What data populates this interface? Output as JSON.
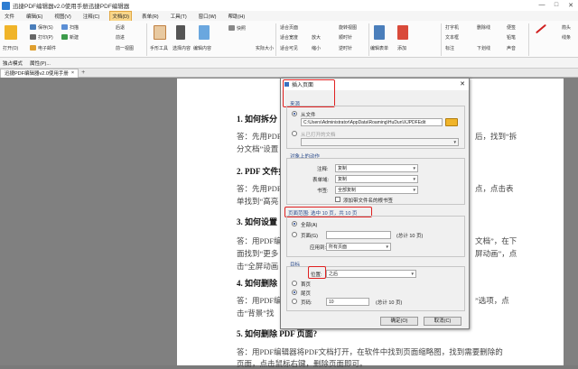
{
  "window": {
    "title": "迅捷PDF编辑器v2.0使用手册迅捷PDF编辑器"
  },
  "menu": [
    "文件",
    "编辑(E)",
    "视图(V)",
    "注释(C)",
    "文档(D)",
    "表单(R)",
    "工具(T)",
    "窗口(W)",
    "帮助(H)"
  ],
  "ribbon": {
    "open": "打开(O)",
    "save": "保存(S)",
    "print": "打印(P)",
    "email": "电子邮件",
    "scan": "扫描",
    "create": "新建",
    "back": "后退",
    "forward": "前进",
    "prev_view": "前一视图",
    "next_view": "后一视图",
    "hand_tool": "手形工具",
    "select_content": "选择内容",
    "edit_content": "编辑内容",
    "add_text": "添加文本",
    "snapshot": "快照",
    "actual_size": "实际大小",
    "fit_page": "适合页面",
    "fit_width": "适合宽度",
    "fit_visible": "适合可见",
    "find": "查找",
    "zoom_in": "放大",
    "zoom_out": "缩小",
    "zoom_pct": "100%",
    "rotate_view": "旋转视图",
    "rotate_cw": "顺时针",
    "rotate_ccw": "逆时针",
    "typewriter": "打字机",
    "textbox": "文本框",
    "callout": "标注",
    "strikeout": "删除线",
    "underline": "下划线",
    "sticky": "便签",
    "pencil": "铅笔",
    "sound": "声音",
    "arrow": "箭头",
    "line": "线条",
    "edit_form": "编辑表单",
    "insert_page": "插入页面",
    "add_item": "添加"
  },
  "modebar": [
    "独占模式",
    "属性(P)..."
  ],
  "tab": {
    "label": "迅捷PDF编辑器v2.0使用手册",
    "close": "×"
  },
  "document": {
    "h1": "1.  如何拆分",
    "p1a": "答：先用PDF",
    "p1a_r": "后，找到“拆",
    "p1b": "分文档”设置",
    "h2": "2.  PDF 文件如",
    "p2a": "答：先用PDF",
    "p2a_r": "点，点击表",
    "p2b": "单找到“高亮",
    "h3": "3.  如何设置",
    "p3a": "答：用PDF编",
    "p3a_r": "文档”，在下",
    "p3b": "面找到“更多",
    "p3b_r": "屏动画”，点",
    "p3c": "击“全屏动画",
    "h4": "4.  如何删除",
    "p4a": "答：用PDF编",
    "p4a_r": "”选项，点",
    "p4b": "击“背景”找",
    "h5": "5.  如何删除 PDF 页面?",
    "p5a": "答：用PDF编辑器将PDF文档打开，在软件中找到页面缩略图，找到需要删除的",
    "p5b": "页面，点击鼠标右键，删除页面即可。"
  },
  "dialog": {
    "title": "插入页面",
    "source_label": "来源",
    "from_file": "从文件",
    "file_path": "C:\\Users\\Administrator\\AppData\\Roaming\\HuDun\\XJPDFEdit",
    "from_open": "从已打开的文档",
    "actions_label": "对象上的动作",
    "comments_label": "注释:",
    "comments_value": "复制",
    "forms_label": "表单域:",
    "forms_value": "复制",
    "bookmarks_label": "书签:",
    "bookmarks_value": "全部复制",
    "add_bookmark": "添加带文件名的根书签",
    "range_label": "页面范围: 选中 10 页，共 10 页",
    "all": "全部(A)",
    "pages": "页面(G)",
    "pages_total": "(总计 10 页)",
    "apply_label": "应用到:",
    "apply_value": "所有页面",
    "target_label": "目标",
    "position_label": "位置:",
    "position_value": "之后",
    "first": "首页",
    "last": "尾页",
    "page_num": "页码:",
    "page_num_value": "10",
    "page_num_total": "(总计 10 页)",
    "ok": "确定(O)",
    "cancel": "取消(C)"
  }
}
